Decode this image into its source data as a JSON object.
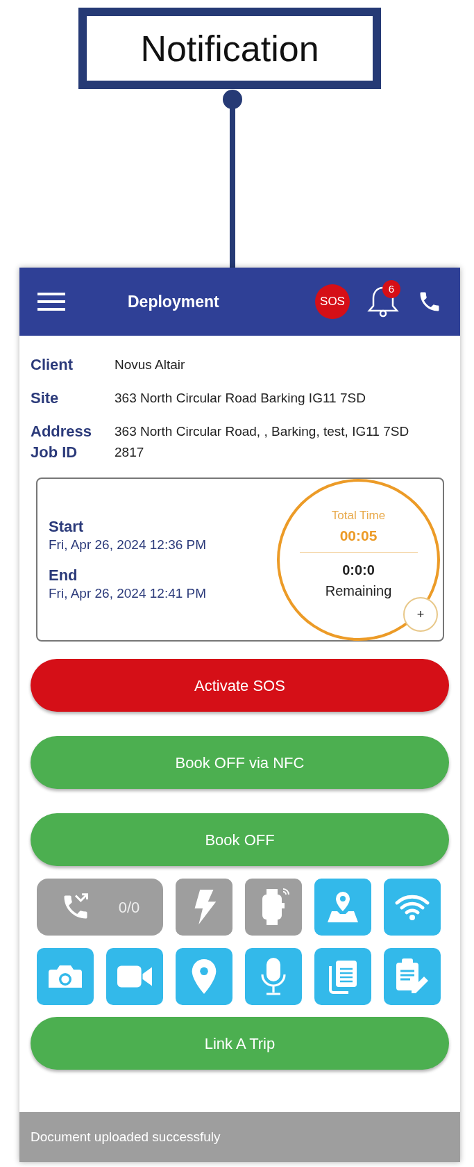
{
  "callout": {
    "label": "Notification"
  },
  "header": {
    "title": "Deployment",
    "sos_badge": "SOS",
    "notification_count": "6"
  },
  "details": [
    {
      "label": "Client",
      "value": "Novus Altair"
    },
    {
      "label": "Site",
      "value": "363 North Circular Road Barking IG11 7SD"
    },
    {
      "label": "Address",
      "value": "363 North Circular Road, , Barking, test, IG11 7SD"
    },
    {
      "label": "Job ID",
      "value": "2817"
    }
  ],
  "schedule": {
    "start_label": "Start",
    "start_value": "Fri, Apr 26, 2024 12:36 PM",
    "end_label": "End",
    "end_value": "Fri, Apr 26, 2024 12:41 PM",
    "total_time_label": "Total Time",
    "total_time": "00:05",
    "remaining_time": "0:0:0",
    "remaining_label": "Remaining",
    "add_button": "+"
  },
  "buttons": [
    {
      "label": "Activate SOS",
      "kind": "danger"
    },
    {
      "label": "Book OFF via NFC",
      "kind": "success"
    },
    {
      "label": "Book OFF",
      "kind": "success"
    }
  ],
  "tools": [
    {
      "count": "0/0",
      "disabled": true
    },
    {
      "disabled": true
    },
    {
      "disabled": true
    },
    {
      "disabled": false
    },
    {
      "disabled": false
    },
    {
      "disabled": false
    },
    {
      "disabled": false
    },
    {
      "disabled": false
    },
    {
      "disabled": false
    },
    {
      "disabled": false
    },
    {
      "disabled": false
    }
  ],
  "link_button": {
    "label": "Link A Trip"
  },
  "toast": {
    "message": "Document uploaded successfuly"
  }
}
